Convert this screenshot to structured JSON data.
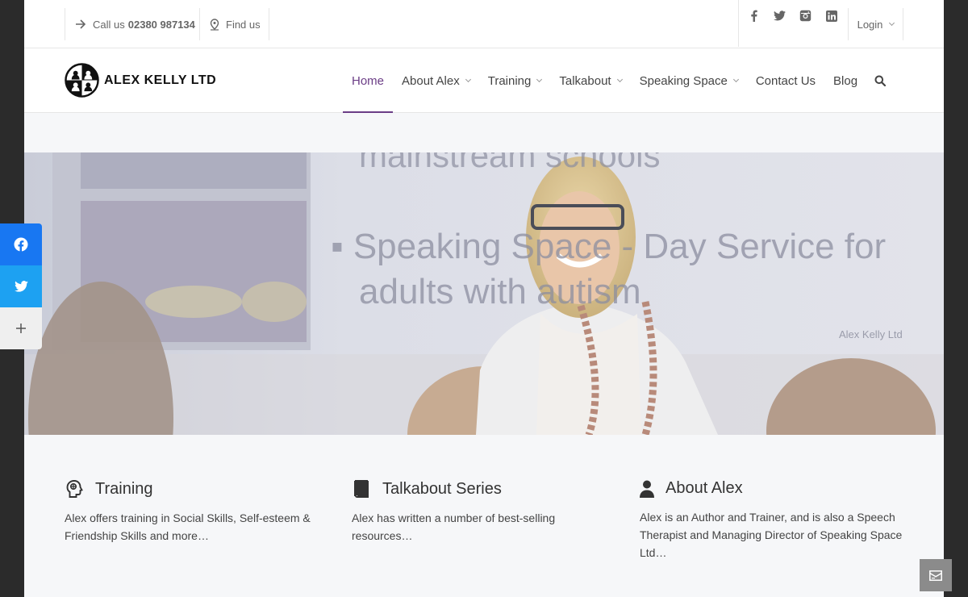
{
  "topbar": {
    "call_prefix": "Call us",
    "phone": "02380 987134",
    "find_us": "Find us",
    "social": [
      "facebook-icon",
      "twitter-icon",
      "instagram-icon",
      "linkedin-icon"
    ],
    "login": "Login"
  },
  "header": {
    "logo_text": "ALEX KELLY LTD",
    "nav": [
      {
        "label": "Home",
        "active": true,
        "dropdown": false
      },
      {
        "label": "About Alex",
        "dropdown": true
      },
      {
        "label": "Training",
        "dropdown": true
      },
      {
        "label": "Talkabout",
        "dropdown": true
      },
      {
        "label": "Speaking Space",
        "dropdown": true
      },
      {
        "label": "Contact Us",
        "dropdown": false
      },
      {
        "label": "Blog",
        "dropdown": false
      }
    ]
  },
  "hero": {
    "slide_line1": "mainstream schools",
    "slide_line2": "▪  Speaking Space - Day Service for",
    "slide_line3": "adults with autism",
    "slide_tag": "Alex Kelly Ltd"
  },
  "features": [
    {
      "title": "Training",
      "icon": "head-icon",
      "text": "Alex offers training in Social Skills, Self-esteem & Friendship Skills and more…"
    },
    {
      "title": "Talkabout Series",
      "icon": "book-icon",
      "text": "Alex has written a number of best-selling resources…"
    },
    {
      "title": "About Alex",
      "icon": "user-icon",
      "text": "Alex is an Author and Trainer, and is also a Speech Therapist and Managing Director of Speaking Space Ltd…"
    }
  ],
  "colors": {
    "accent": "#6b3d86",
    "facebook": "#1877f2",
    "twitter": "#1da1f2"
  }
}
